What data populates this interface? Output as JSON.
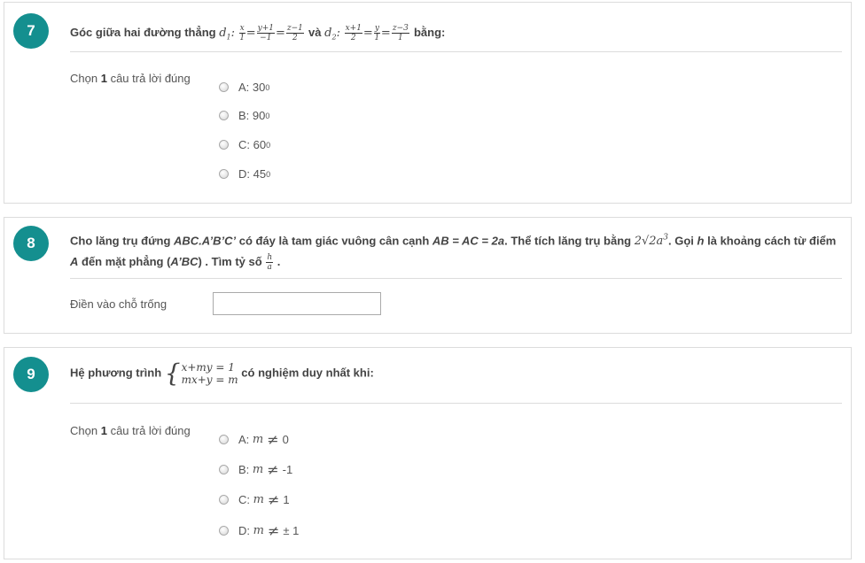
{
  "questions": [
    {
      "number": "7",
      "text_intro": "Góc giữa hai đường thẳng",
      "d1": "d",
      "d1_sub": "1",
      "d1_expr": {
        "f1n": "x",
        "f1d": "1",
        "f2n": "y+1",
        "f2d": "−1",
        "f3n": "z−1",
        "f3d": "2"
      },
      "and": "và",
      "d2": "d",
      "d2_sub": "2",
      "d2_expr": {
        "f1n": "x+1",
        "f1d": "2",
        "f2n": "y",
        "f2d": "1",
        "f3n": "z−3",
        "f3d": "1"
      },
      "text_end": "bằng:",
      "prompt_pre": "Chọn",
      "prompt_num": "1",
      "prompt_post": "câu trả lời đúng",
      "options": [
        {
          "label": "A: 30",
          "sup": "0"
        },
        {
          "label": "B: 90",
          "sup": "0"
        },
        {
          "label": "C: 60",
          "sup": "0"
        },
        {
          "label": "D: 45",
          "sup": "0"
        }
      ]
    },
    {
      "number": "8",
      "line1_a": "Cho lăng trụ đứng",
      "line1_b": "ABC.A’B’C’",
      "line1_c": "có đáy là tam giác vuông cân cạnh",
      "line1_d": "AB = AC = 2a",
      "line1_e": ". Thể tích lăng trụ bằng",
      "volume": "2√2a",
      "volume_sup": "3",
      "line1_f": ". Gọi",
      "line1_g": "h",
      "line1_h": "là khoảng cách từ điểm",
      "line2_a": "A",
      "line2_b": "đến mặt phẳng (",
      "line2_c": "A’BC",
      "line2_d": ") . Tìm tỷ số",
      "ratio_num": "h",
      "ratio_den": "a",
      "line2_e": ".",
      "prompt": "Điền vào chỗ trống",
      "input_value": ""
    },
    {
      "number": "9",
      "text_intro": "Hệ phương trình",
      "row1": "x+my = 1",
      "row2": "mx+y = m",
      "text_end": "có nghiệm duy nhất khi:",
      "prompt_pre": "Chọn",
      "prompt_num": "1",
      "prompt_post": "câu trả lời đúng",
      "options": [
        {
          "prefix": "A:",
          "var": "m",
          "sym": "≠",
          "val": "0"
        },
        {
          "prefix": "B:",
          "var": "m",
          "sym": "≠",
          "val": "-1"
        },
        {
          "prefix": "C:",
          "var": "m",
          "sym": "≠",
          "val": "1"
        },
        {
          "prefix": "D:",
          "var": "m",
          "sym": "≠",
          "val": "± 1"
        }
      ]
    }
  ],
  "colors": {
    "badge": "#148f8f",
    "border": "#dcdcdc"
  }
}
